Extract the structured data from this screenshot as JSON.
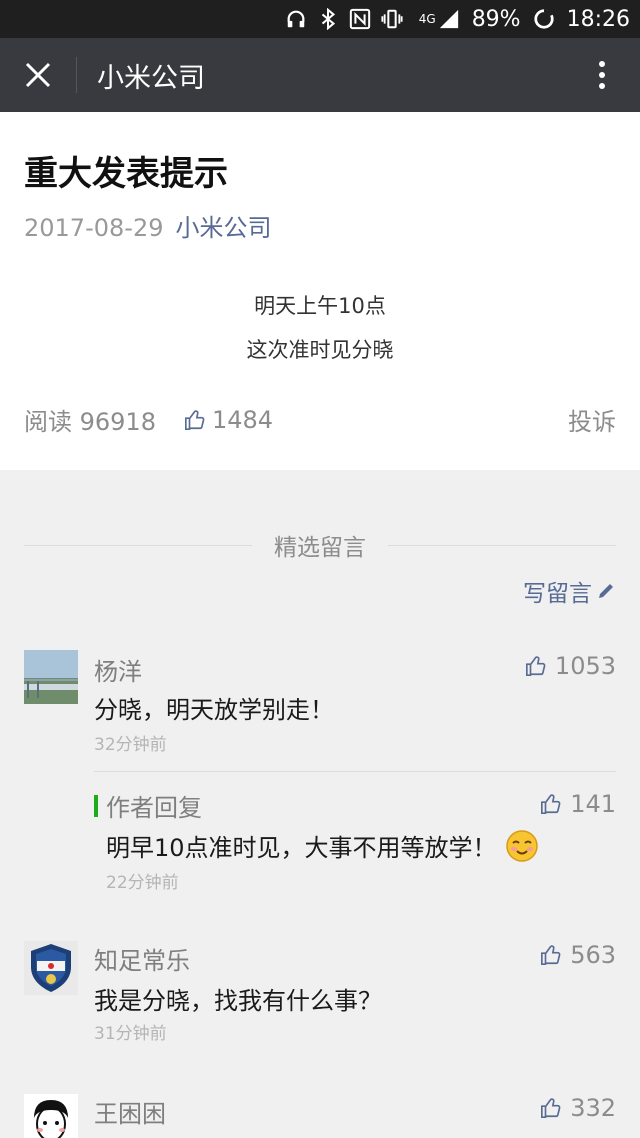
{
  "status": {
    "network": "4G",
    "battery": "89%",
    "time": "18:26"
  },
  "navbar": {
    "title": "小米公司"
  },
  "article": {
    "title": "重大发表提示",
    "date": "2017-08-29",
    "author": "小米公司",
    "body": [
      "明天上午10点",
      "这次准时见分晓"
    ],
    "reads": "阅读 96918",
    "likes": "1484",
    "report": "投诉"
  },
  "comments_section": {
    "heading": "精选留言",
    "write": "写留言",
    "items": [
      {
        "name": "杨洋",
        "likes": "1053",
        "text": "分晓，明天放学别走！",
        "time": "32分钟前"
      },
      {
        "name": "知足常乐",
        "likes": "563",
        "text": "我是分晓，找我有什么事？",
        "time": "31分钟前"
      },
      {
        "name": "王困困",
        "likes": "332"
      }
    ],
    "reply": {
      "label": "作者回复",
      "likes": "141",
      "text": "明早10点准时见，大事不用等放学！",
      "time": "22分钟前"
    }
  },
  "colors": {
    "navbar": "#393a3f",
    "link": "#576b95",
    "reply_accent": "#1aad19"
  },
  "icons": [
    "headphones-icon",
    "bluetooth-icon",
    "nfc-icon",
    "vibrate-icon",
    "signal-icon",
    "battery-icon",
    "close-icon",
    "more-icon",
    "thumbs-up-icon",
    "pencil-icon",
    "smile-emoji-icon"
  ]
}
